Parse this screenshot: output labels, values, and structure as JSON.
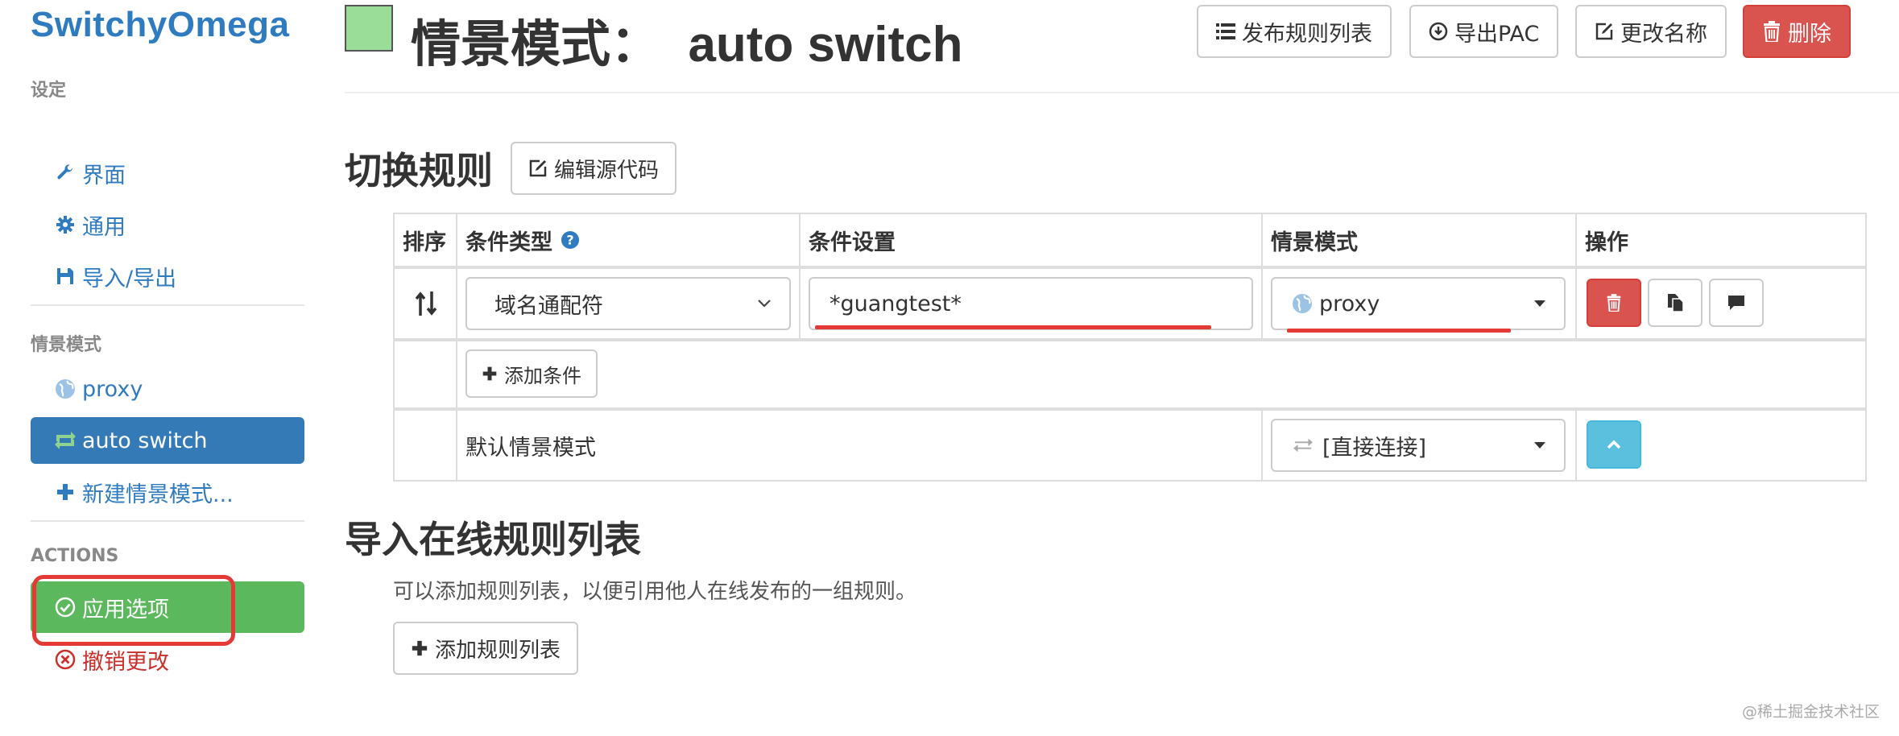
{
  "app": {
    "brand": "SwitchyOmega"
  },
  "sidebar": {
    "settings_header": "设定",
    "settings_items": [
      {
        "label": "界面",
        "icon": "wrench-icon"
      },
      {
        "label": "通用",
        "icon": "gear-icon"
      },
      {
        "label": "导入/导出",
        "icon": "floppy-icon"
      }
    ],
    "profiles_header": "情景模式",
    "profiles": [
      {
        "label": "proxy",
        "icon": "globe-icon",
        "active": false
      },
      {
        "label": "auto switch",
        "icon": "switch-icon",
        "active": true
      }
    ],
    "new_profile": "新建情景模式...",
    "actions_header": "ACTIONS",
    "apply_label": "应用选项",
    "discard_label": "撤销更改"
  },
  "header": {
    "swatch_color": "#99dd99",
    "title": "情景模式：  auto switch",
    "buttons": {
      "publish": "发布规则列表",
      "export_pac": "导出PAC",
      "rename": "更改名称",
      "delete": "删除"
    }
  },
  "switch_rules": {
    "title": "切换规则",
    "edit_source": "编辑源代码",
    "columns": {
      "order": "排序",
      "condition_type": "条件类型",
      "condition": "条件设置",
      "profile": "情景模式",
      "actions": "操作"
    },
    "rows": [
      {
        "condition_type": "域名通配符",
        "condition": "*guangtest*",
        "profile": "proxy"
      }
    ],
    "add_condition": "添加条件",
    "default_label": "默认情景模式",
    "default_profile": "[直接连接]"
  },
  "rule_lists": {
    "title": "导入在线规则列表",
    "description": "可以添加规则列表，以便引用他人在线发布的一组规则。",
    "add_button": "添加规则列表"
  },
  "watermark": "@稀土掘金技术社区",
  "colors": {
    "brand": "#2f7bbf",
    "active": "#337ab7",
    "apply": "#5cb85c",
    "danger": "#d9534f",
    "info": "#5bc0de",
    "annotation": "#e53935"
  }
}
